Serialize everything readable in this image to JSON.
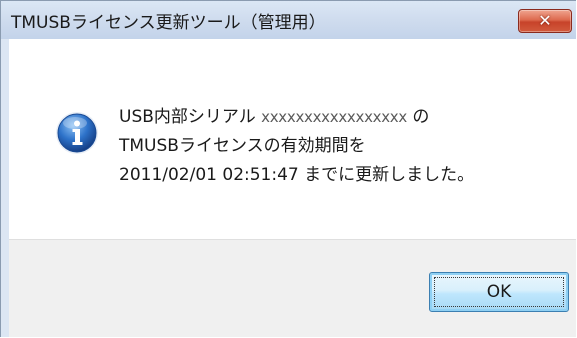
{
  "window": {
    "title": "TMUSBライセンス更新ツール（管理用）",
    "close_label": "✕"
  },
  "message": {
    "icon": "info-icon",
    "line1_prefix": "USB内部シリアル",
    "serial": "xxxxxxxxxxxxxxxxx",
    "line1_suffix": "の",
    "line2": "TMUSBライセンスの有効期間を",
    "line3": "2011/02/01 02:51:47 までに更新しました。"
  },
  "buttons": {
    "ok_label": "OK"
  },
  "colors": {
    "titlebar": "#cfdcee",
    "close_button": "#c7432a",
    "info_icon": "#1f5fb7",
    "footer": "#f0f0f0",
    "ok_border": "#3c7fb1"
  }
}
